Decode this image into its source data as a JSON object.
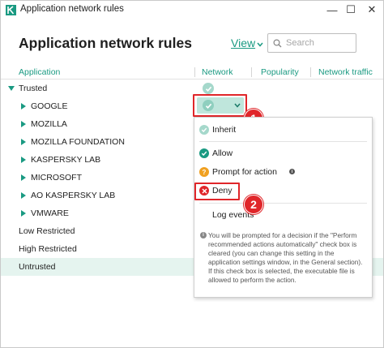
{
  "window": {
    "title": "Application network rules",
    "minimize_symbol": "—",
    "maximize_symbol": "☐",
    "close_symbol": "✕"
  },
  "header": {
    "title": "Application network rules",
    "view_label": "View",
    "search_placeholder": "Search"
  },
  "columns": {
    "application": "Application",
    "network": "Network",
    "popularity": "Popularity",
    "traffic": "Network traffic"
  },
  "groups": {
    "trusted": "Trusted",
    "low_restricted": "Low Restricted",
    "high_restricted": "High Restricted",
    "untrusted": "Untrusted"
  },
  "trusted_apps": [
    "GOOGLE",
    "MOZILLA",
    "MOZILLA FOUNDATION",
    "KASPERSKY LAB",
    "MICROSOFT",
    "AO KASPERSKY LAB",
    "VMWARE"
  ],
  "menu": {
    "inherit": "Inherit",
    "allow": "Allow",
    "prompt": "Prompt for action",
    "deny": "Deny",
    "log_events": "Log events",
    "note": "You will be prompted for a decision if the \"Perform recommended actions automatically\" check box is cleared (you can change this setting in the application settings window, in the General section). If this check box is selected, the executable file is allowed to perform the action."
  },
  "annotations": {
    "step1": "1",
    "step2": "2"
  },
  "colors": {
    "accent": "#1a9a82",
    "check_light": "#a5d8cb",
    "selected_cell": "#bfe6dc",
    "untrusted_bg": "#e5f4ef",
    "deny_red": "#e0262a",
    "prompt_orange": "#f0a020",
    "allow_green": "#1a9a82"
  },
  "icons": {
    "app_logo": "kaspersky-k-logo",
    "search": "search-icon",
    "check": "check-icon",
    "question": "question-icon",
    "deny": "deny-x-icon",
    "info": "info-icon"
  }
}
